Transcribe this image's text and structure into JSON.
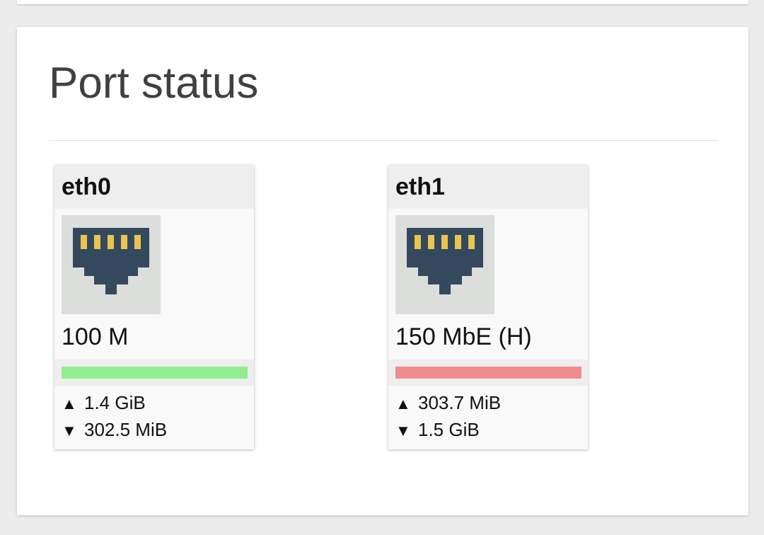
{
  "panel": {
    "title": "Port status"
  },
  "ports": [
    {
      "name": "eth0",
      "icon": "ethernet-port-icon",
      "speed": "100 M",
      "status_color": "#90ee90",
      "tx_arrow": "▲",
      "tx": "1.4 GiB",
      "rx_arrow": "▼",
      "rx": "302.5 MiB"
    },
    {
      "name": "eth1",
      "icon": "ethernet-port-icon",
      "speed": "150 MbE (H)",
      "status_color": "#f08c8c",
      "tx_arrow": "▲",
      "tx": "303.7 MiB",
      "rx_arrow": "▼",
      "rx": "1.5 GiB"
    }
  ],
  "colors": {
    "port_icon_bg": "#dcdedc",
    "port_icon_body": "#34495e",
    "port_icon_pins": "#e9c550"
  }
}
